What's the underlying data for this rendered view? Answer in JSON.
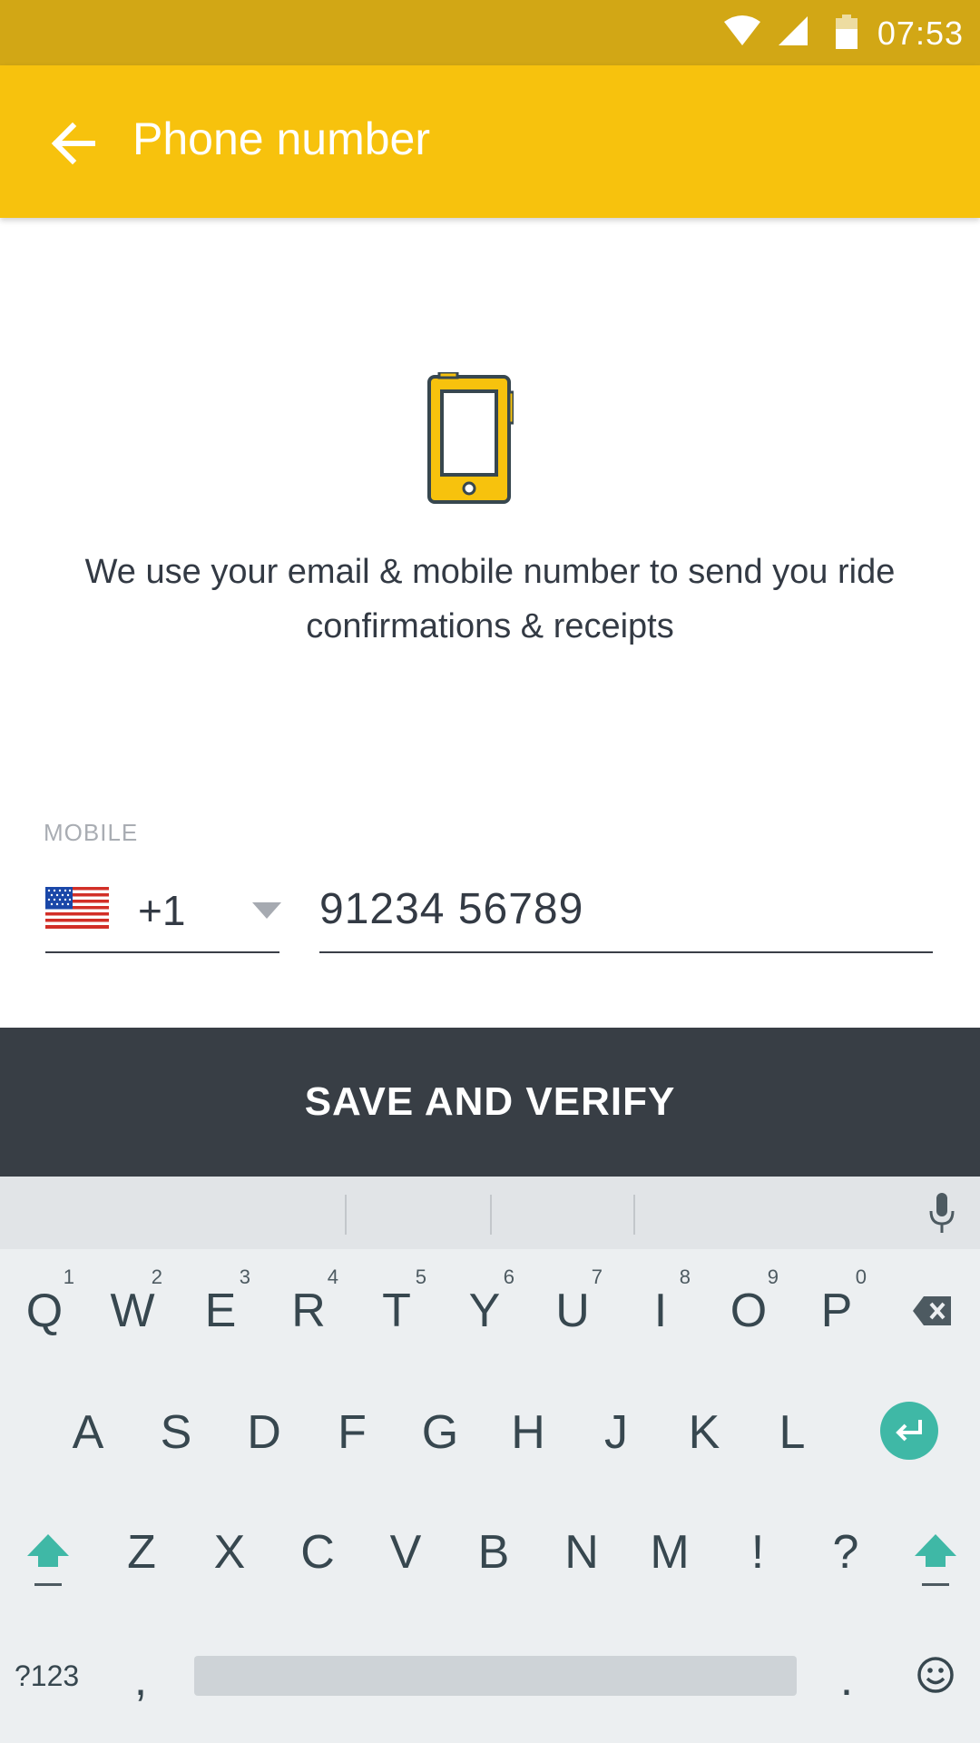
{
  "status_bar": {
    "time": "07:53"
  },
  "app_bar": {
    "title": "Phone number"
  },
  "content": {
    "info_text": "We use your email & mobile number to send you ride confirmations & receipts",
    "mobile_label": "MOBILE",
    "country_code": "+1",
    "phone_value": "91234 56789"
  },
  "save_button": {
    "label": "SAVE AND VERIFY"
  },
  "keyboard": {
    "row1": [
      {
        "label": "Q",
        "hint": "1"
      },
      {
        "label": "W",
        "hint": "2"
      },
      {
        "label": "E",
        "hint": "3"
      },
      {
        "label": "R",
        "hint": "4"
      },
      {
        "label": "T",
        "hint": "5"
      },
      {
        "label": "Y",
        "hint": "6"
      },
      {
        "label": "U",
        "hint": "7"
      },
      {
        "label": "I",
        "hint": "8"
      },
      {
        "label": "O",
        "hint": "9"
      },
      {
        "label": "P",
        "hint": "0"
      }
    ],
    "row2": [
      "A",
      "S",
      "D",
      "F",
      "G",
      "H",
      "J",
      "K",
      "L"
    ],
    "row3": [
      "Z",
      "X",
      "C",
      "V",
      "B",
      "N",
      "M",
      "!",
      "?"
    ],
    "symbols_label": "?123",
    "comma": ",",
    "period": "."
  },
  "colors": {
    "status_bar": "#d2a715",
    "app_bar": "#f7c20d",
    "button": "#383e45",
    "accent": "#3fb8a6"
  },
  "icons": [
    "wifi-icon",
    "signal-icon",
    "battery-icon",
    "back-arrow-icon",
    "phone-icon",
    "us-flag-icon",
    "mic-icon",
    "backspace-icon",
    "enter-icon",
    "shift-icon",
    "emoji-icon"
  ]
}
